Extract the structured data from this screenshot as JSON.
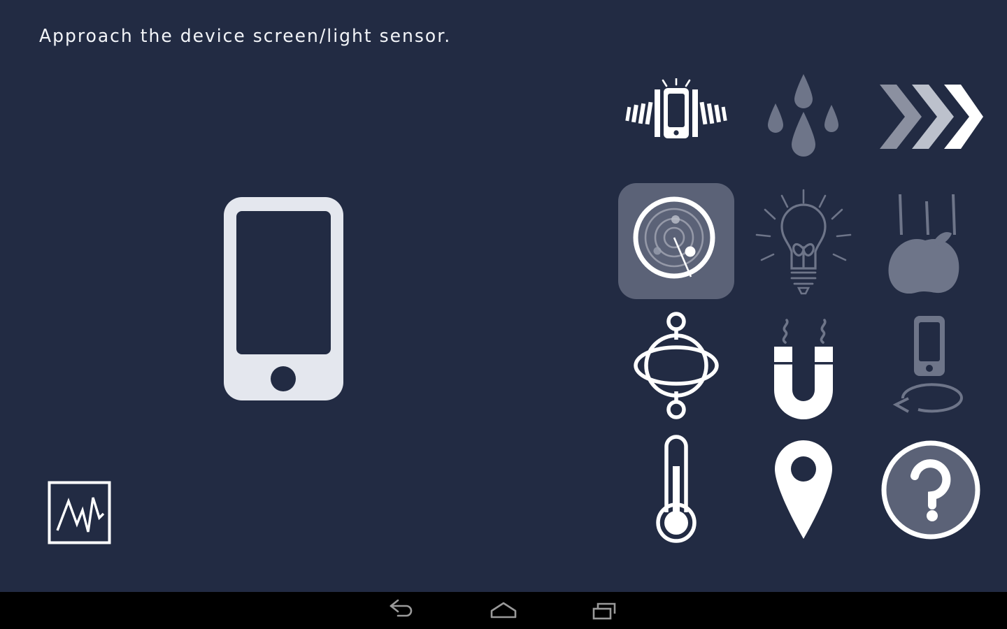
{
  "app": {
    "background_color": "#222b43",
    "navbar_color": "#000000",
    "accent_selected_color": "#5b6277",
    "active_icon_color": "#ffffff",
    "dimmed_icon_color": "#6e7589"
  },
  "instruction": {
    "text": "Approach the device screen/light sensor."
  },
  "illustration": {
    "name": "smartphone-illustration",
    "body_color": "#e4e7ee",
    "screen_color": "#222b43"
  },
  "graph_button": {
    "name": "graph-view-button",
    "label": "Graph"
  },
  "sensor_grid": {
    "rows": 4,
    "columns": 3,
    "items": [
      {
        "id": "vibration",
        "label": "Vibration",
        "state": "active",
        "icon": "vibrating-phone-icon"
      },
      {
        "id": "humidity",
        "label": "Humidity",
        "state": "dimmed",
        "icon": "water-drops-icon"
      },
      {
        "id": "acceleration",
        "label": "Acceleration",
        "state": "active",
        "icon": "chevrons-icon"
      },
      {
        "id": "proximity",
        "label": "Proximity",
        "state": "selected",
        "icon": "proximity-radar-icon"
      },
      {
        "id": "light",
        "label": "Light",
        "state": "dimmed",
        "icon": "light-bulb-icon"
      },
      {
        "id": "gravity",
        "label": "Gravity",
        "state": "dimmed",
        "icon": "falling-apple-icon"
      },
      {
        "id": "gyroscope",
        "label": "Gyroscope",
        "state": "active",
        "icon": "gyroscope-icon"
      },
      {
        "id": "magnetometer",
        "label": "Magnetic field",
        "state": "active",
        "icon": "magnet-icon"
      },
      {
        "id": "rotation",
        "label": "Device rotation",
        "state": "dimmed",
        "icon": "device-rotation-icon"
      },
      {
        "id": "temperature",
        "label": "Temperature",
        "state": "active",
        "icon": "thermometer-icon"
      },
      {
        "id": "location",
        "label": "Location",
        "state": "active",
        "icon": "location-pin-icon"
      },
      {
        "id": "help",
        "label": "Help",
        "state": "active",
        "icon": "question-mark-icon"
      }
    ]
  },
  "navbar": {
    "back_label": "Back",
    "home_label": "Home",
    "recents_label": "Recent apps"
  }
}
